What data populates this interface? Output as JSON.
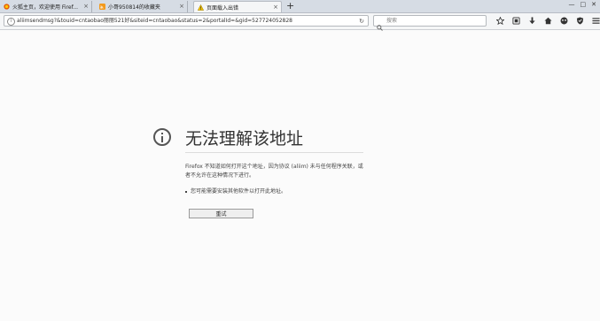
{
  "tabs": [
    {
      "label": "火狐主页，欢迎使用 Firef...",
      "active": false,
      "favicon": "firefox-icon"
    },
    {
      "label": "小哥950814的收藏夹",
      "active": false,
      "favicon": "rss-icon"
    },
    {
      "label": "页面载入出错",
      "active": true,
      "favicon": "warning-icon"
    }
  ],
  "tab_close_symbol": "×",
  "new_tab_symbol": "+",
  "window_controls": [
    "—",
    "□",
    "✕"
  ],
  "url": "aliimsendmsg?&touid=cntaobao丽丽521好&siteid=cntaobao&status=2&portalId=&gid=527724052828",
  "reload_symbol": "↻",
  "search_placeholder": "搜索",
  "toolbar_icons": [
    "star-icon",
    "reading-list-icon",
    "downloads-icon",
    "home-icon",
    "pocket-icon",
    "shield-icon",
    "menu-icon"
  ],
  "error": {
    "title": "无法理解该地址",
    "description": "Firefox 不知道如何打开这个地址，因为协议 (aliim) 未与任何程序关联，或者不允许在这种情况下进行。",
    "bullet": "您可能需要安装其他软件以打开此地址。",
    "retry_label": "重试"
  },
  "colors": {
    "tabstrip": "#d6dce4",
    "toolbar": "#f5f6f7",
    "page": "#fbfbfb"
  }
}
